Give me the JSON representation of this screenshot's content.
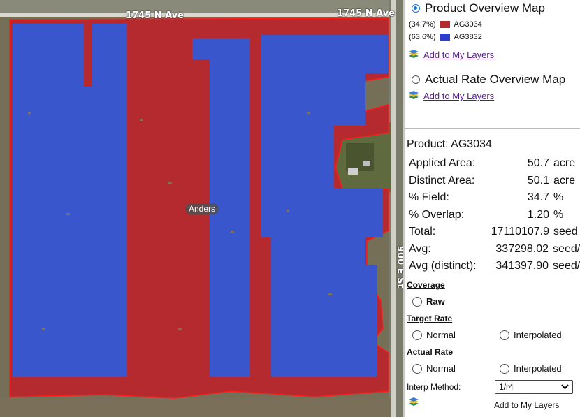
{
  "map": {
    "road_north_left": "1745 N Ave",
    "road_north_right": "1745 N Ave",
    "road_east": "900 E St",
    "field_name": "Anders",
    "colors": {
      "ag3034": "#b52a2e",
      "ag3832": "#3a56cc",
      "boundary": "#ff1a1a"
    }
  },
  "panel": {
    "product_map_label": "Product Overview Map",
    "legend": [
      {
        "pct": "(34.7%)",
        "name": "AG3034",
        "color": "#b52a2e"
      },
      {
        "pct": "(63.6%)",
        "name": "AG3832",
        "color": "#2c3fcc"
      }
    ],
    "add_layers_1": "Add to My Layers",
    "actual_rate_map_label": "Actual Rate Overview Map",
    "add_layers_2": "Add to My Layers",
    "product_title": "Product: AG3034",
    "stats": [
      {
        "label": "Applied Area:",
        "value": "50.7",
        "unit": "acre"
      },
      {
        "label": "Distinct Area:",
        "value": "50.1",
        "unit": "acre"
      },
      {
        "label": "% Field:",
        "value": "34.7",
        "unit": "%"
      },
      {
        "label": "% Overlap:",
        "value": "1.20",
        "unit": "%"
      },
      {
        "label": "Total:",
        "value": "17110107.9",
        "unit": "seed"
      },
      {
        "label": "Avg:",
        "value": "337298.02",
        "unit": "seed/"
      },
      {
        "label": "Avg (distinct):",
        "value": "341397.90",
        "unit": "seed/"
      }
    ],
    "coverage_label": "Coverage",
    "raw_label": "Raw",
    "target_rate_label": "Target Rate",
    "target_normal": "Normal",
    "target_interpolated": "Interpolated",
    "actual_rate_label": "Actual Rate",
    "actual_normal": "Normal",
    "actual_interpolated": "Interpolated",
    "interp_method_label": "Interp Method:",
    "interp_method_value": "1/r4",
    "add_layers_3": "Add to My Layers"
  }
}
